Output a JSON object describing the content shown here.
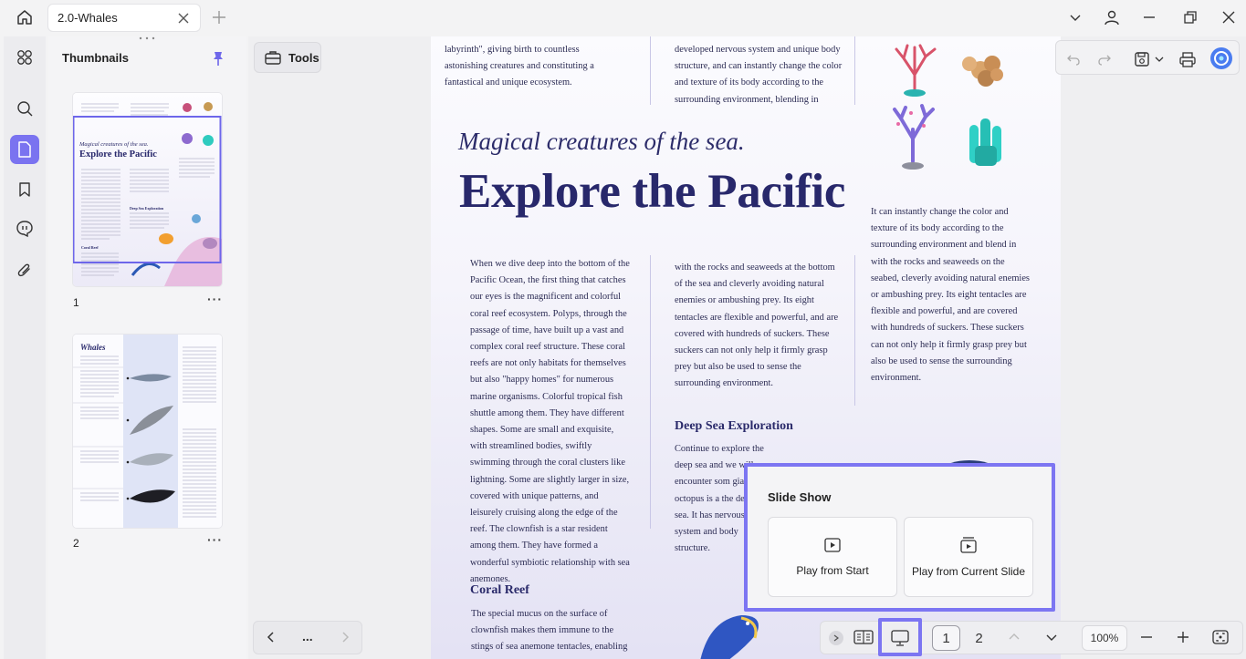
{
  "tab": {
    "title": "2.0-Whales"
  },
  "thumbnails": {
    "title": "Thumbnails",
    "pages": [
      {
        "number": "1",
        "heading": "Explore the Pacific",
        "subheading": "Magical creatures of the sea.",
        "section": "Deep Sea Exploration",
        "section2": "Coral Reef"
      },
      {
        "number": "2",
        "heading": "Whales"
      }
    ]
  },
  "tools": {
    "label": "Tools"
  },
  "document": {
    "top_col1": "labyrinth\", giving birth to countless astonishing creatures and constituting a fantastical and unique ecosystem.",
    "top_col2": "developed nervous system and unique body structure, and can instantly change the color and texture of its body according to the surrounding environment, blending in",
    "subtitle": "Magical creatures of the sea.",
    "title": "Explore the Pacific",
    "right_col": "It can instantly change the color and texture of its body according to the surrounding environment and blend in with the rocks and seaweeds on the seabed, cleverly avoiding natural enemies or ambushing prey. Its eight tentacles are flexible and powerful, and are covered with hundreds of suckers. These suckers can not only help it firmly grasp prey but also be used to sense the surrounding environment.",
    "col1": "When we dive deep into the bottom of the Pacific Ocean, the first thing that catches our eyes is the magnificent and colorful coral reef ecosystem. Polyps, through the passage of time, have built up a vast and complex coral reef structure. These coral reefs are not only habitats for themselves but also \"happy homes\" for numerous marine organisms. Colorful tropical fish shuttle among them. They have different shapes. Some are small and exquisite, with streamlined bodies, swiftly swimming through the coral clusters like lightning. Some are slightly larger in size, covered with unique patterns, and leisurely cruising along the edge of the reef. The clownfish is a star resident among them. They have formed a wonderful symbiotic relationship with sea anemones.",
    "col2": "with the rocks and seaweeds at the bottom of the sea and cleverly avoiding natural enemies or ambushing prey. Its eight tentacles are flexible and powerful, and are covered with hundreds of suckers. These suckers can not only help it firmly grasp prey but also be used to sense the surrounding environment.",
    "deep_sea_heading": "Deep Sea Exploration",
    "deep_sea_text": "Continue to explore the deep sea and we will encounter som giant octopus is a the deep sea. It has nervous system and body structure.",
    "coral_reef_heading": "Coral Reef",
    "coral_reef_text": "The special mucus on the surface of clownfish makes them immune to the stings of sea anemone tentacles, enabling"
  },
  "slideshow": {
    "title": "Slide Show",
    "play_start": "Play from Start",
    "play_current": "Play from Current Slide"
  },
  "bottombar": {
    "page1": "1",
    "page2": "2",
    "zoom": "100%"
  },
  "navbar": {
    "more": "..."
  },
  "colors": {
    "accent": "#7a73f0",
    "heading": "#28286b"
  }
}
